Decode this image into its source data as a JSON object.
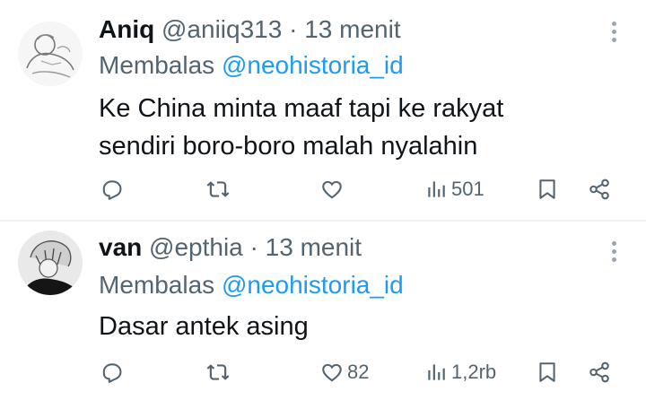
{
  "tweets": [
    {
      "name": "Aniq",
      "handle": "@aniiq313",
      "separator": "·",
      "time": "13 menit",
      "reply_prefix": "Membalas",
      "reply_mention": "@neohistoria_id",
      "text_line1": "Ke China minta maaf tapi ke rakyat",
      "text_line2": "sendiri boro-boro malah nyalahin",
      "likes": "",
      "views": "501"
    },
    {
      "name": "van",
      "handle": "@epthia",
      "separator": "·",
      "time": "13 menit",
      "reply_prefix": "Membalas",
      "reply_mention": "@neohistoria_id",
      "text_line1": "Dasar antek asing",
      "likes": "82",
      "views": "1,2rb"
    }
  ],
  "icons": {
    "reply": "reply-icon",
    "retweet": "retweet-icon",
    "like": "heart-icon",
    "views": "views-icon",
    "bookmark": "bookmark-icon",
    "share": "share-icon",
    "more": "more-vertical-icon"
  },
  "colors": {
    "text": "#0f1419",
    "secondary": "#536471",
    "mention": "#1d9bf0",
    "divider": "#eff3f4"
  }
}
